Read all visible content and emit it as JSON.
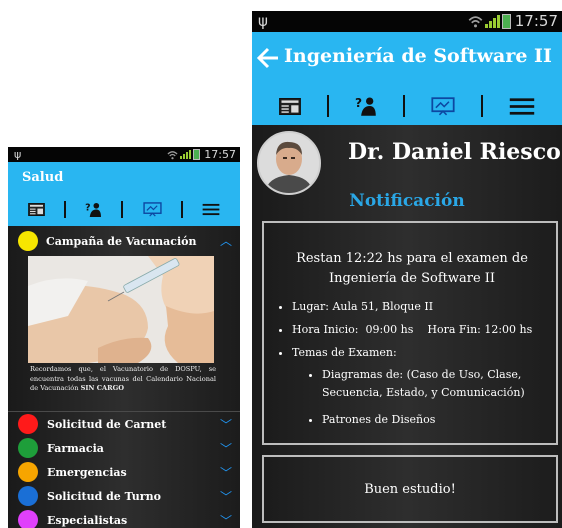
{
  "left_phone": {
    "status": {
      "time": "17:57"
    },
    "app_title": "Salud",
    "toolbar_icons": [
      "newspaper-icon",
      "question-person-icon",
      "presentation-icon",
      "menu-icon"
    ],
    "expanded_section": {
      "label": "Campaña de Vacunación",
      "dot_color": "#f7e600",
      "caption_text": "Recordamos que, el Vacunatorio de DOSPU, se encuentra todas las vacunas del Calendario Nacional de Vacunación",
      "caption_emphasis": "SIN CARGO"
    },
    "menu_items": [
      {
        "label": "Solicitud de Carnet",
        "color": "#ff1a1a"
      },
      {
        "label": "Farmacia",
        "color": "#1e9e3a"
      },
      {
        "label": "Emergencias",
        "color": "#f7a500"
      },
      {
        "label": "Solicitud de Turno",
        "color": "#1a6fd6"
      },
      {
        "label": "Especialistas",
        "color": "#e040fb"
      }
    ]
  },
  "right_phone": {
    "status": {
      "time": "17:57"
    },
    "app_title": "Ingeniería de Software II",
    "toolbar_icons": [
      "newspaper-icon",
      "question-person-icon",
      "presentation-icon",
      "menu-icon"
    ],
    "teacher_name": "Dr. Daniel Riesco",
    "notification_title": "Notificación",
    "message": {
      "intro": "Restan 12:22 hs para el examen de Ingeniería de Software II",
      "bullets": [
        "Lugar: Aula 51, Bloque II",
        "Hora Inicio:  09:00 hs    Hora Fin: 12:00 hs",
        "Temas de Examen:"
      ],
      "sub_bullets": [
        "Diagramas de: (Caso de Uso, Clase, Secuencia, Estado, y Comunicación)",
        "Patrones de Diseños"
      ]
    },
    "closing": "Buen estudio!"
  },
  "colors": {
    "accent": "#29b6f1",
    "notification": "#2aa7e6"
  }
}
